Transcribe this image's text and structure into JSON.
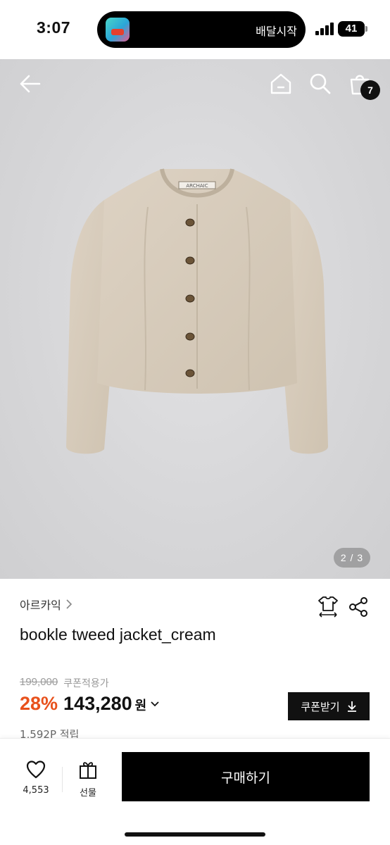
{
  "status_bar": {
    "time": "3:07",
    "island_text": "배달시작",
    "battery": "41"
  },
  "header": {
    "cart_count": "7",
    "icons": [
      "back-arrow-icon",
      "home-icon",
      "search-icon",
      "shopping-bag-icon"
    ]
  },
  "gallery": {
    "pager": "2 / 3",
    "jacket_tag": "ARCHAIC"
  },
  "product": {
    "brand": "아르카익",
    "name": "bookle tweed jacket_cream",
    "original_price": "199,000",
    "coupon_label": "쿠폰적용가",
    "discount": "28%",
    "price": "143,280",
    "currency": "원",
    "coupon_button": "쿠폰받기",
    "points": "1,592P 적립"
  },
  "bottom_bar": {
    "like_count": "4,553",
    "gift_label": "선물",
    "buy_label": "구매하기"
  },
  "colors": {
    "accent_discount": "#e8511c",
    "primary_button": "#000000",
    "jacket": "#d8ccbb"
  }
}
